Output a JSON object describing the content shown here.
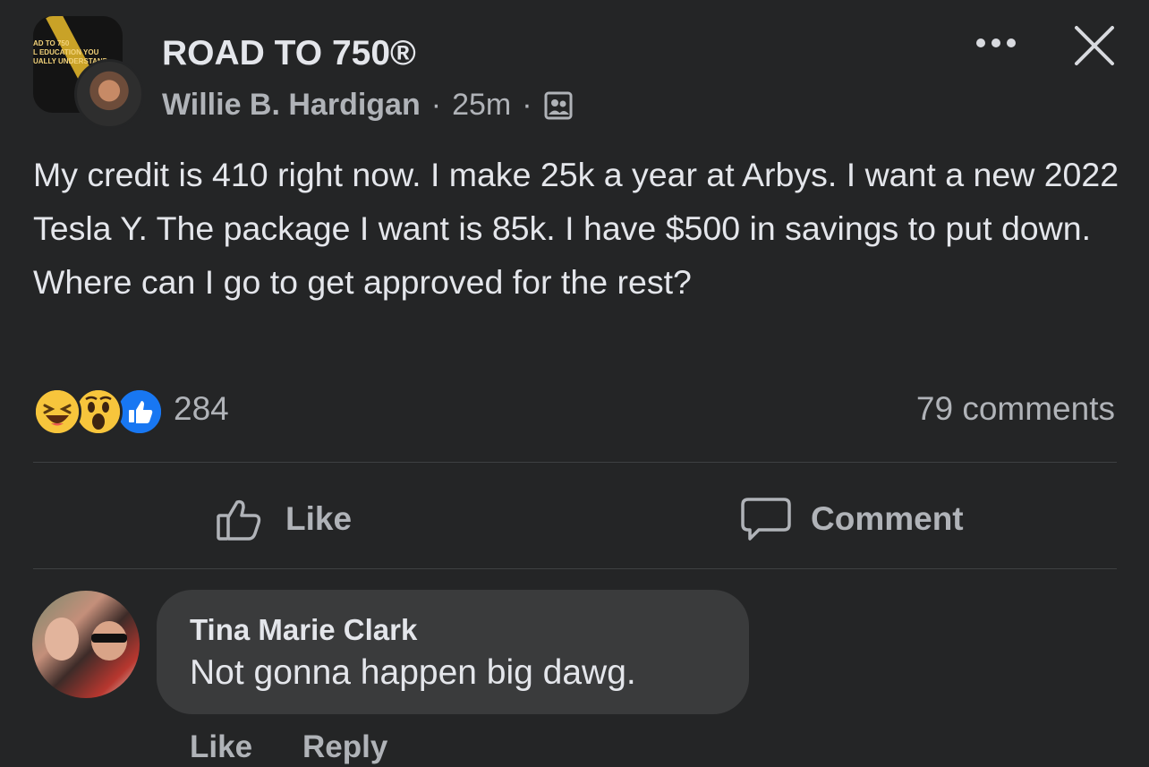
{
  "post": {
    "group_name": "ROAD TO 750®",
    "group_logo_text": [
      "AD TO 750",
      "L EDUCATION YOU",
      "UALLY UNDERSTAND"
    ],
    "author": "Willie B. Hardigan",
    "separator": "·",
    "timestamp": "25m",
    "privacy_icon": "group-members-icon",
    "body": "My credit is 410 right now. I make 25k a year at Arbys. I want a new 2022 Tesla Y. The package I want is 85k. I have $500 in savings to put down. Where can I go to get approved for the rest?",
    "reactions": [
      "haha",
      "wow",
      "like"
    ],
    "reaction_count": "284",
    "comment_count": "79 comments"
  },
  "actions": {
    "like_label": "Like",
    "comment_label": "Comment"
  },
  "comment": {
    "author": "Tina Marie Clark",
    "text": "Not gonna happen big dawg.",
    "like_label": "Like",
    "reply_label": "Reply"
  },
  "colors": {
    "background": "#242526",
    "bubble": "#3a3b3c",
    "primary_text": "#e4e6eb",
    "secondary_text": "#b0b3b8",
    "like_blue": "#1877f2",
    "reaction_yellow": "#f7c53c"
  }
}
